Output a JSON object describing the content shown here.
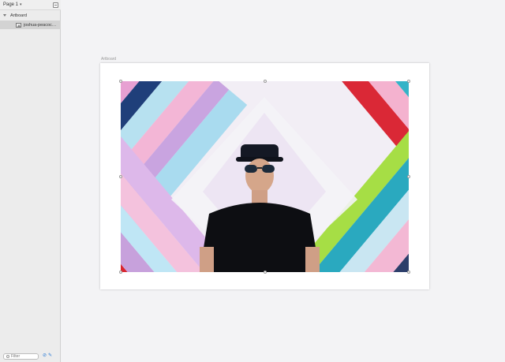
{
  "sidebar": {
    "page": {
      "label": "Page 1"
    },
    "layers": [
      {
        "label": "Artboard",
        "type": "artboard"
      },
      {
        "label": "joshua-peacoc…",
        "type": "image"
      }
    ],
    "filter": {
      "placeholder": "Filter"
    }
  },
  "canvas": {
    "artboard_label": "Artboard",
    "background": "#f3f3f5",
    "artboard_color": "#ffffff"
  },
  "icons": [
    "caret-down-icon",
    "add-page-icon",
    "disclosure-triangle-icon",
    "image-layer-icon",
    "search-icon",
    "edit-icon",
    "slice-icon"
  ]
}
